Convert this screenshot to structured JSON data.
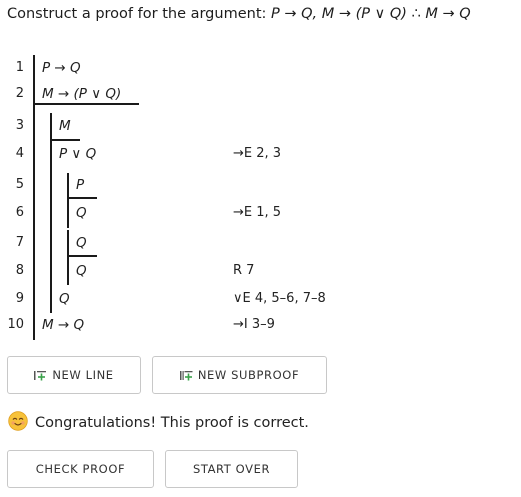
{
  "prompt": {
    "lead": "Construct a proof for the argument: ",
    "formula": "P → Q, M → (P ∨ Q) ∴ M → Q"
  },
  "proof": {
    "lines": [
      {
        "num": "1",
        "formula": "P → Q",
        "just": ""
      },
      {
        "num": "2",
        "formula": "M → (P ∨ Q)",
        "just": ""
      },
      {
        "num": "3",
        "formula": "M",
        "just": ""
      },
      {
        "num": "4",
        "formula": "P ∨ Q",
        "just": "→E 2, 3"
      },
      {
        "num": "5",
        "formula": "P",
        "just": ""
      },
      {
        "num": "6",
        "formula": "Q",
        "just": "→E 1, 5"
      },
      {
        "num": "7",
        "formula": "Q",
        "just": ""
      },
      {
        "num": "8",
        "formula": "Q",
        "just": "R 7"
      },
      {
        "num": "9",
        "formula": "Q",
        "just": "∨E 4, 5–6, 7–8"
      },
      {
        "num": "10",
        "formula": "M → Q",
        "just": "→I 3–9"
      }
    ]
  },
  "buttons": {
    "new_line": "NEW LINE",
    "new_subproof": "NEW SUBPROOF",
    "check_proof": "CHECK PROOF",
    "start_over": "START OVER"
  },
  "status": {
    "icon": "smiling-face-icon",
    "message": "Congratulations! This proof is correct."
  },
  "colors": {
    "accent_green": "#3aa14a",
    "bar": "#1a1a1a",
    "button_border": "#c8c8c8"
  }
}
